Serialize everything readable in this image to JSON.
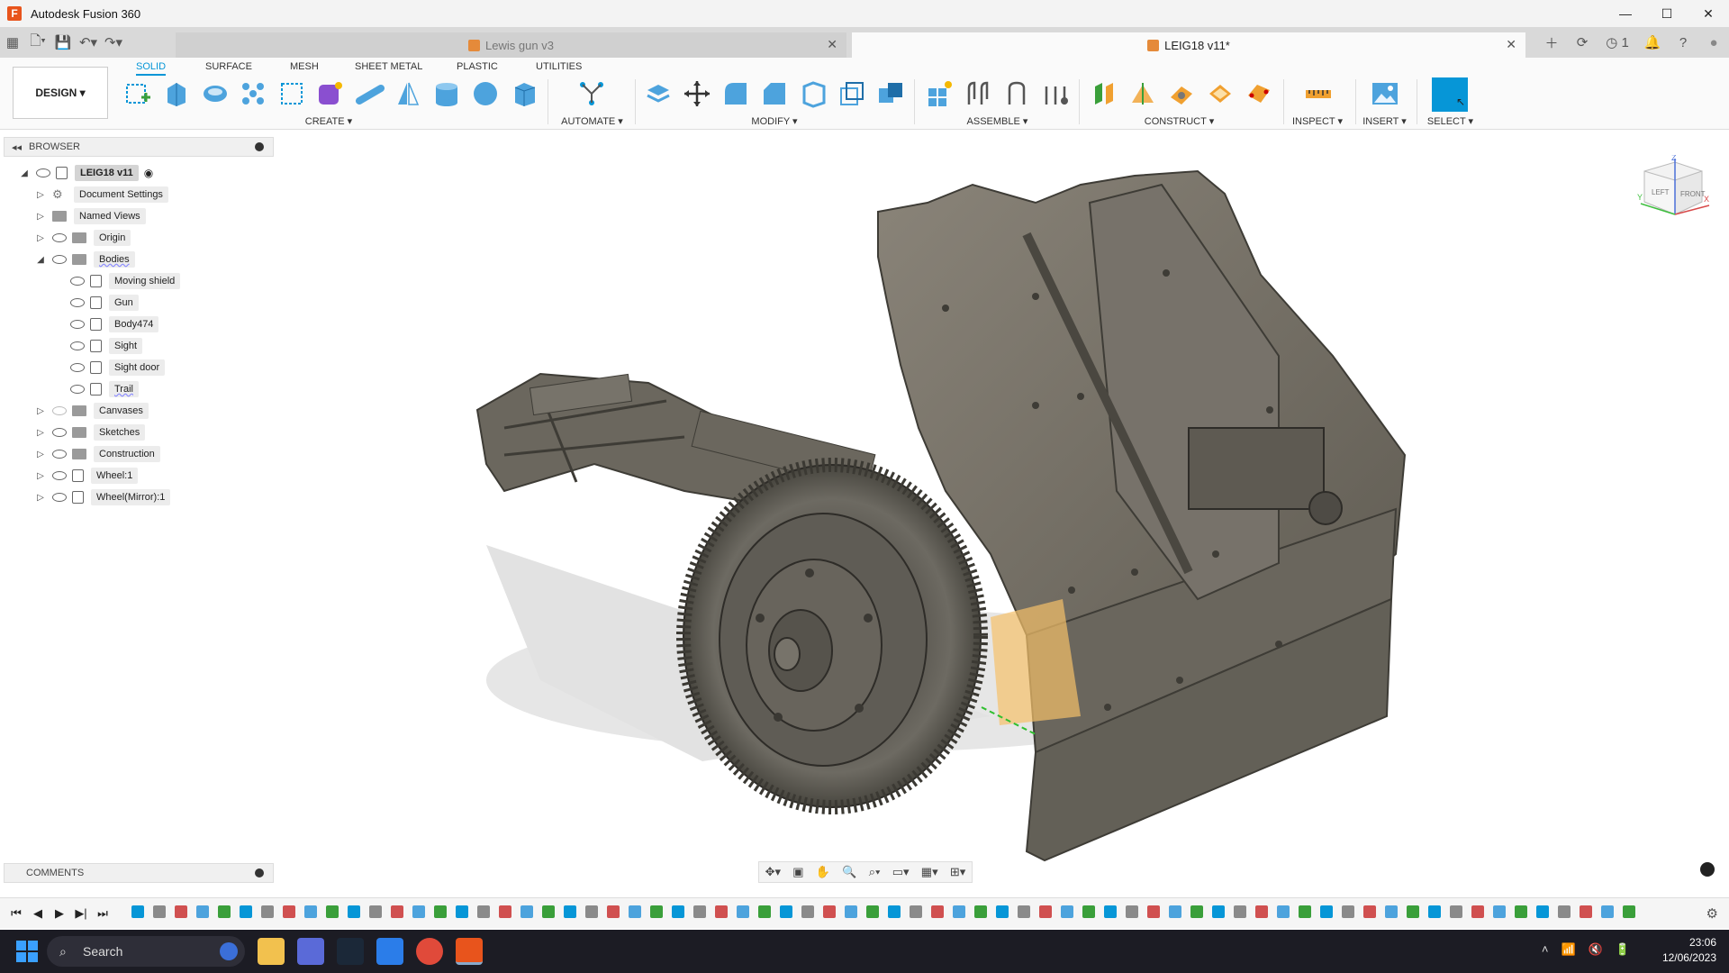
{
  "window": {
    "title": "Autodesk Fusion 360"
  },
  "tabs": [
    {
      "label": "Lewis gun v3",
      "active": false
    },
    {
      "label": "LEIG18 v11*",
      "active": true
    }
  ],
  "quick_access": [
    "grid-icon",
    "file-icon",
    "save-icon",
    "undo-icon",
    "redo-icon"
  ],
  "tab_right": {
    "jobs_count": "1"
  },
  "toolbar": {
    "workspace": "DESIGN ▾",
    "workspace_tabs": [
      "SOLID",
      "SURFACE",
      "MESH",
      "SHEET METAL",
      "PLASTIC",
      "UTILITIES"
    ],
    "active_tab": "SOLID",
    "groups": [
      "CREATE ▾",
      "AUTOMATE ▾",
      "MODIFY ▾",
      "ASSEMBLE ▾",
      "CONSTRUCT ▾",
      "INSPECT ▾",
      "INSERT ▾",
      "SELECT ▾"
    ]
  },
  "browser": {
    "title": "BROWSER",
    "root": "LEIG18 v11",
    "items": [
      {
        "label": "Document Settings"
      },
      {
        "label": "Named Views"
      },
      {
        "label": "Origin"
      },
      {
        "label": "Bodies"
      },
      {
        "label": "Moving shield"
      },
      {
        "label": "Gun"
      },
      {
        "label": "Body474"
      },
      {
        "label": "Sight"
      },
      {
        "label": "Sight door"
      },
      {
        "label": "Trail"
      },
      {
        "label": "Canvases"
      },
      {
        "label": "Sketches"
      },
      {
        "label": "Construction"
      },
      {
        "label": "Wheel:1"
      },
      {
        "label": "Wheel(Mirror):1"
      }
    ]
  },
  "viewcube": {
    "left": "LEFT",
    "front": "FRONT",
    "z": "Z",
    "x": "X",
    "y": "Y"
  },
  "comments": {
    "title": "COMMENTS"
  },
  "taskbar": {
    "search": "Search",
    "time": "23:06",
    "date": "12/06/2023"
  },
  "colors": {
    "accent": "#0696d7",
    "model": "#6b665c",
    "fusion_orange": "#e8541c"
  }
}
